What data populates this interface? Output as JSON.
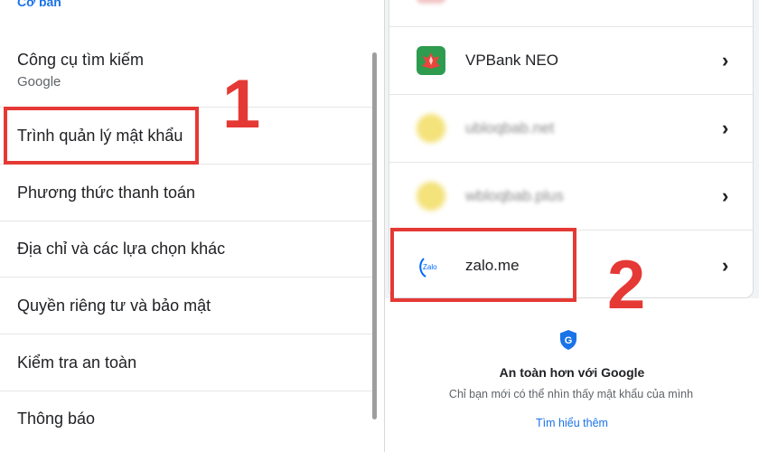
{
  "left_panel": {
    "section_title": "Cơ bản",
    "items": [
      {
        "label": "Công cụ tìm kiếm",
        "sub": "Google"
      },
      {
        "label": "Trình quản lý mật khẩu"
      },
      {
        "label": "Phương thức thanh toán"
      },
      {
        "label": "Địa chỉ và các lựa chọn khác"
      },
      {
        "label": "Quyền riêng tư và bảo mật"
      },
      {
        "label": "Kiểm tra an toàn"
      },
      {
        "label": "Thông báo"
      }
    ]
  },
  "right_panel": {
    "sites": [
      {
        "name": "VPBank NEO",
        "icon": "vpbank-logo"
      },
      {
        "name": "ubloqbab.net",
        "icon": "blurred-site-icon"
      },
      {
        "name": "wbloqbab.plus",
        "icon": "blurred-site-icon"
      },
      {
        "name": "zalo.me",
        "icon": "zalo-logo",
        "icon_text": "Zalo"
      }
    ],
    "safety": {
      "title": "An toàn hơn với Google",
      "description": "Chỉ bạn mới có thể nhìn thấy mật khẩu của mình",
      "link": "Tìm hiểu thêm"
    }
  },
  "annotations": {
    "step1": "1",
    "step2": "2",
    "highlight_color": "#e53935"
  },
  "colors": {
    "accent": "#1a73e8",
    "vpbank": "#2e9b4f",
    "zalo": "#0068ff"
  }
}
